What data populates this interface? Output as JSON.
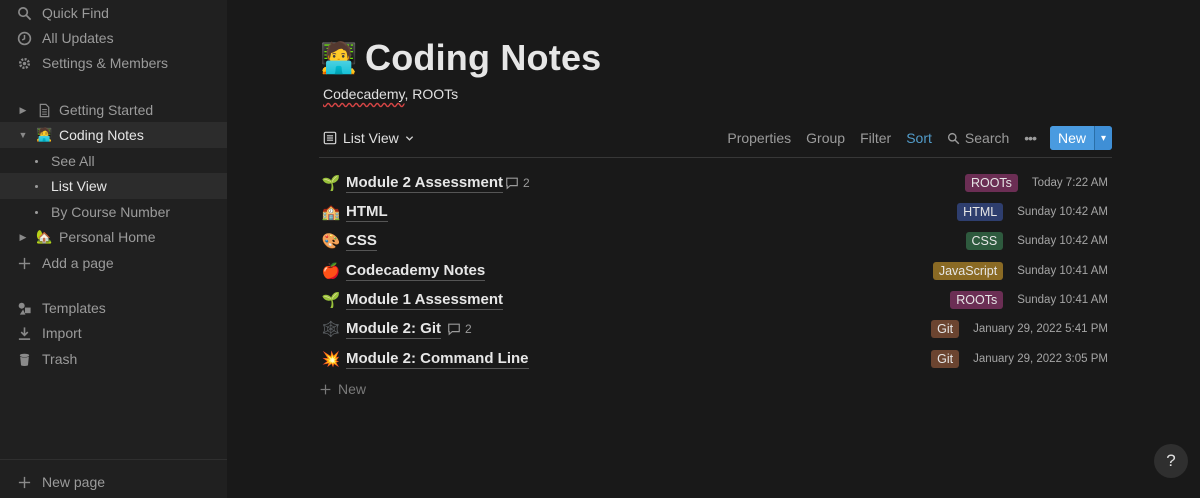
{
  "sidebar": {
    "top_items": [
      {
        "label": "Quick Find",
        "icon": "search-icon"
      },
      {
        "label": "All Updates",
        "icon": "clock-icon"
      },
      {
        "label": "Settings & Members",
        "icon": "gear-icon"
      }
    ],
    "pages": [
      {
        "label": "Getting Started",
        "icon": "document-icon"
      },
      {
        "label": "Coding Notes",
        "emoji": "🧑‍💻"
      },
      {
        "label": "See All"
      },
      {
        "label": "List View"
      },
      {
        "label": "By Course Number"
      },
      {
        "label": "Personal Home",
        "emoji": "🏡"
      }
    ],
    "add_page": "Add a page",
    "bottom_items": [
      {
        "label": "Templates",
        "icon": "templates-icon"
      },
      {
        "label": "Import",
        "icon": "import-icon"
      },
      {
        "label": "Trash",
        "icon": "trash-icon"
      }
    ],
    "new_page": "New page"
  },
  "page": {
    "emoji": "🧑‍💻",
    "title": "Coding Notes",
    "subtitle_word1": "Codecademy",
    "subtitle_rest": ", ROOTs"
  },
  "toolbar": {
    "view_label": "List View",
    "properties": "Properties",
    "group": "Group",
    "filter": "Filter",
    "sort": "Sort",
    "search": "Search",
    "more": "•••",
    "new": "New",
    "colors": {
      "sort": "#529cca",
      "new_button": "#4a9be0"
    }
  },
  "rows": [
    {
      "emoji": "🌱",
      "title": "Module 2 Assessment",
      "comments": "2",
      "tag": "ROOTs",
      "tag_color": "#6b2e54",
      "date": "Today 7:22 AM"
    },
    {
      "emoji": "🏫",
      "title": "HTML",
      "comments": "",
      "tag": "HTML",
      "tag_color": "#2e3e6e",
      "date": "Sunday 10:42 AM"
    },
    {
      "emoji": "🎨",
      "title": "CSS",
      "comments": "",
      "tag": "CSS",
      "tag_color": "#2e5a3e",
      "date": "Sunday 10:42 AM"
    },
    {
      "emoji": "🍎",
      "title": "Codecademy Notes",
      "comments": "",
      "tag": "JavaScript",
      "tag_color": "#8a6a24",
      "date": "Sunday 10:41 AM"
    },
    {
      "emoji": "🌱",
      "title": "Module 1 Assessment",
      "comments": "",
      "tag": "ROOTs",
      "tag_color": "#6b2e54",
      "date": "Sunday 10:41 AM"
    },
    {
      "emoji": "🕸️",
      "title": "Module 2: Git",
      "comments": "2",
      "tag": "Git",
      "tag_color": "#6b4430",
      "date": "January 29, 2022 5:41 PM"
    },
    {
      "emoji": "💥",
      "title": "Module 2: Command Line",
      "comments": "",
      "tag": "Git",
      "tag_color": "#6b4430",
      "date": "January 29, 2022 3:05 PM"
    }
  ],
  "add_new": "New",
  "help": "?"
}
